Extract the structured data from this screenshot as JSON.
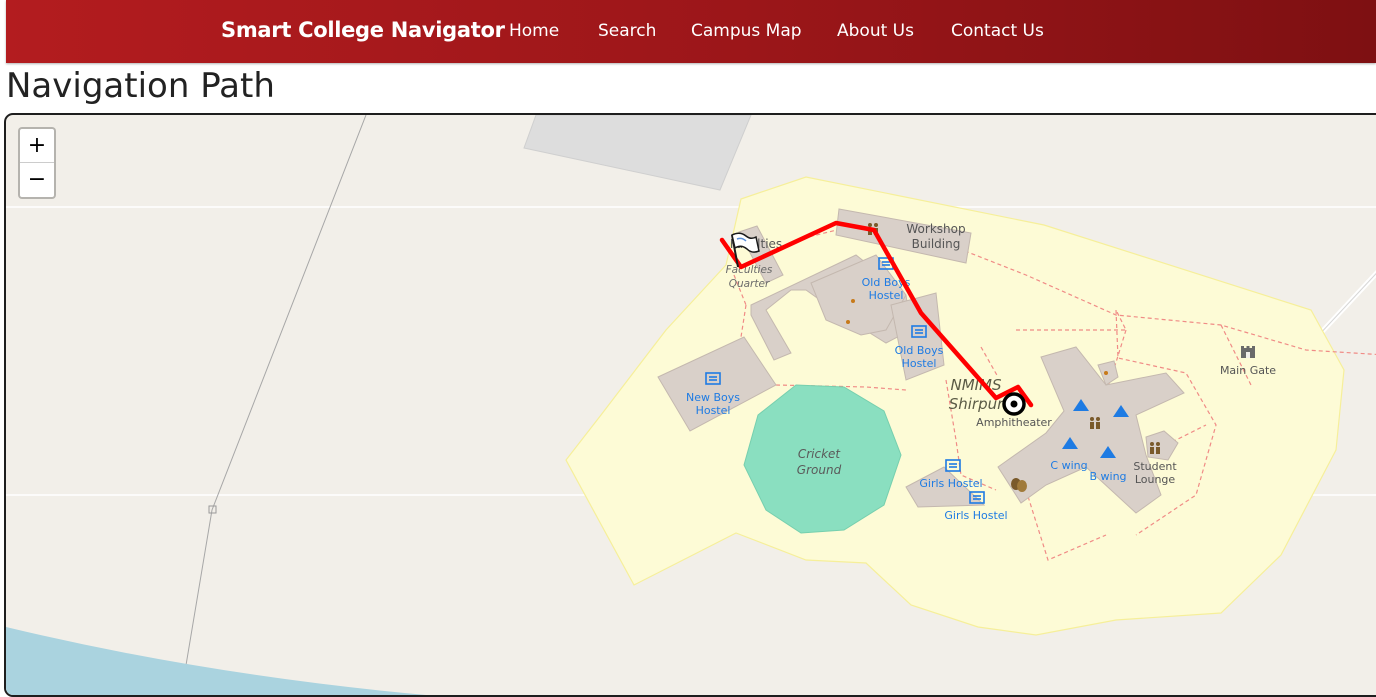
{
  "navbar": {
    "brand": "Smart College Navigator",
    "links": [
      "Home",
      "Search",
      "Campus Map",
      "About Us",
      "Contact Us"
    ]
  },
  "page": {
    "title": "Navigation Path"
  },
  "map": {
    "zoom_in": "+",
    "zoom_out": "−",
    "labels": {
      "faculties_quarter_top": "Faculties\nQuarter",
      "faculties_quarter_italic": "Faculties\nQuarter",
      "workshop": "Workshop\nBuilding",
      "old_boys_1": "Old Boys\nHostel",
      "old_boys_2": "Old Boys\nHostel",
      "new_boys": "New Boys\nHostel",
      "cricket": "Cricket\nGround",
      "nmims": "NMIMS\nShirpur",
      "amphitheater": "Amphitheater",
      "girls_1": "Girls Hostel",
      "girls_2": "Girls Hostel",
      "c_wing": "C wing",
      "b_wing": "B wing",
      "student_lounge": "Student\nLounge",
      "main_gate": "Main Gate"
    },
    "colors": {
      "campus": "#fdfbd6",
      "building": "#d9d0c9",
      "cricket": "#8adfc0",
      "water": "#aad3df",
      "route": "#ff0000",
      "hostel_label": "#1e7be3",
      "footway": "#f08b86"
    },
    "icons": [
      "flag-icon",
      "hostel-icon",
      "camp-icon",
      "people-icon",
      "theatre-icon",
      "destination-icon",
      "gate-icon"
    ]
  }
}
